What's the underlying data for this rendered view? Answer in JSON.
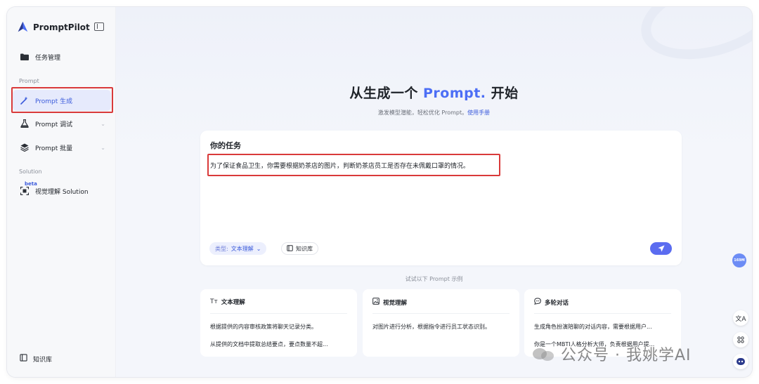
{
  "brand": {
    "name": "PromptPilot"
  },
  "sidebar": {
    "task_mgmt": "任务管理",
    "section_prompt": "Prompt",
    "prompt_generate": "Prompt 生成",
    "prompt_debug": "Prompt 调试",
    "prompt_batch": "Prompt 批量",
    "section_solution": "Solution",
    "beta": "beta",
    "visual_solution": "视觉理解 Solution",
    "knowledge_base": "知识库"
  },
  "hero": {
    "title_prefix": "从生成一个",
    "title_accent": "Prompt.",
    "title_suffix": "开始",
    "subtitle": "激发模型潜能，轻松优化 Prompt。",
    "manual_link": "使用手册"
  },
  "task": {
    "title": "你的任务",
    "text": "为了保证食品卫生，你需要根据奶茶店的图片，判断奶茶店员工是否存在未佩戴口罩的情况。",
    "type_key": "类型:",
    "type_value": "文本理解",
    "knowledge_label": "知识库"
  },
  "examples": {
    "label": "试试以下 Prompt 示例",
    "cards": [
      {
        "title": "文本理解",
        "icon": "text-type-icon",
        "lines": [
          "根据提供的内容审核政策将聊天记录分类。",
          "从提供的文档中提取总结要点，要点数量不超..."
        ]
      },
      {
        "title": "视觉理解",
        "icon": "image-icon",
        "lines": [
          "对图片进行分析，根据指令进行员工状态识别。",
          ""
        ]
      },
      {
        "title": "多轮对话",
        "icon": "chat-icon",
        "lines": [
          "生成角色扮演陪聊的对话内容，需要根据用户...",
          "你是一个MBTI人格分析大师，负责根据用户提..."
        ]
      }
    ]
  },
  "tools": {
    "ram": "169M"
  },
  "watermark": {
    "text": "公众号 · 我姚学AI"
  },
  "colors": {
    "accent": "#4c6ef5",
    "highlight": "#d93a3a",
    "send": "#5b6cf0"
  }
}
